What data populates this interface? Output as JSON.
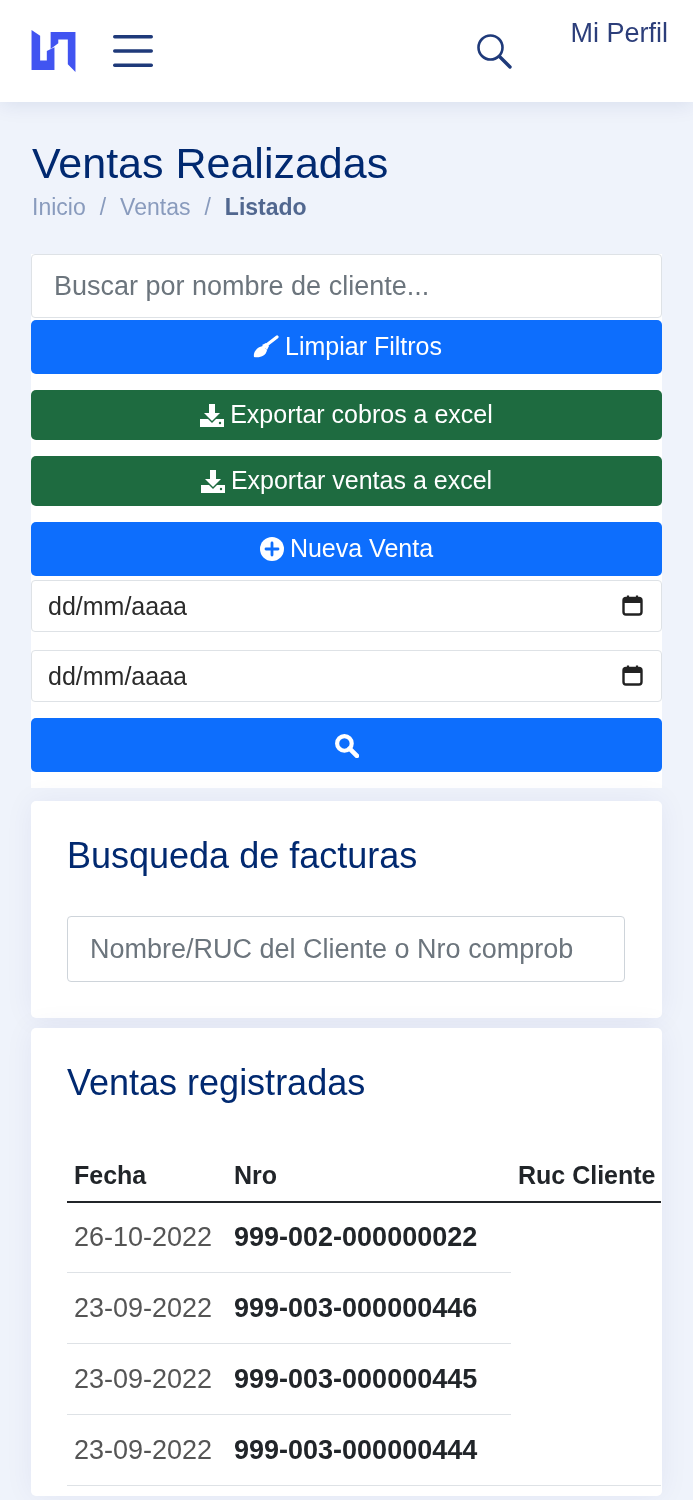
{
  "header": {
    "profile_link": "Mi Perfil"
  },
  "page_title": "Ventas Realizadas",
  "breadcrumb": [
    {
      "kind": "link",
      "label": "Inicio"
    },
    {
      "kind": "separator",
      "label": "/"
    },
    {
      "kind": "link",
      "label": "Ventas"
    },
    {
      "kind": "separator",
      "label": "/"
    },
    {
      "kind": "current",
      "label": "Listado"
    }
  ],
  "filters": [
    {
      "kind": "text-field",
      "placeholder": "Buscar por nombre de cliente..."
    },
    {
      "kind": "clear",
      "label": "Limpiar Filtros"
    },
    {
      "kind": "export",
      "label": "Exportar cobros a excel"
    },
    {
      "kind": "export",
      "label": "Exportar ventas a excel"
    },
    {
      "kind": "new",
      "label": "Nueva Venta"
    },
    {
      "kind": "date",
      "placeholder": "dd/mm/aaaa"
    },
    {
      "kind": "date",
      "placeholder": "dd/mm/aaaa"
    },
    {
      "kind": "search"
    }
  ],
  "invoice_search": {
    "title": "Busqueda de facturas",
    "placeholder": "Nombre/RUC del Cliente o Nro comprob"
  },
  "sales_table": {
    "title": "Ventas registradas",
    "columns": [
      "Fecha",
      "Nro",
      "Ruc Cliente"
    ],
    "rows": [
      {
        "fecha": "26-10-2022",
        "nro": "999-002-000000022"
      },
      {
        "fecha": "23-09-2022",
        "nro": "999-003-000000446"
      },
      {
        "fecha": "23-09-2022",
        "nro": "999-003-000000445"
      },
      {
        "fecha": "23-09-2022",
        "nro": "999-003-000000444"
      }
    ]
  }
}
